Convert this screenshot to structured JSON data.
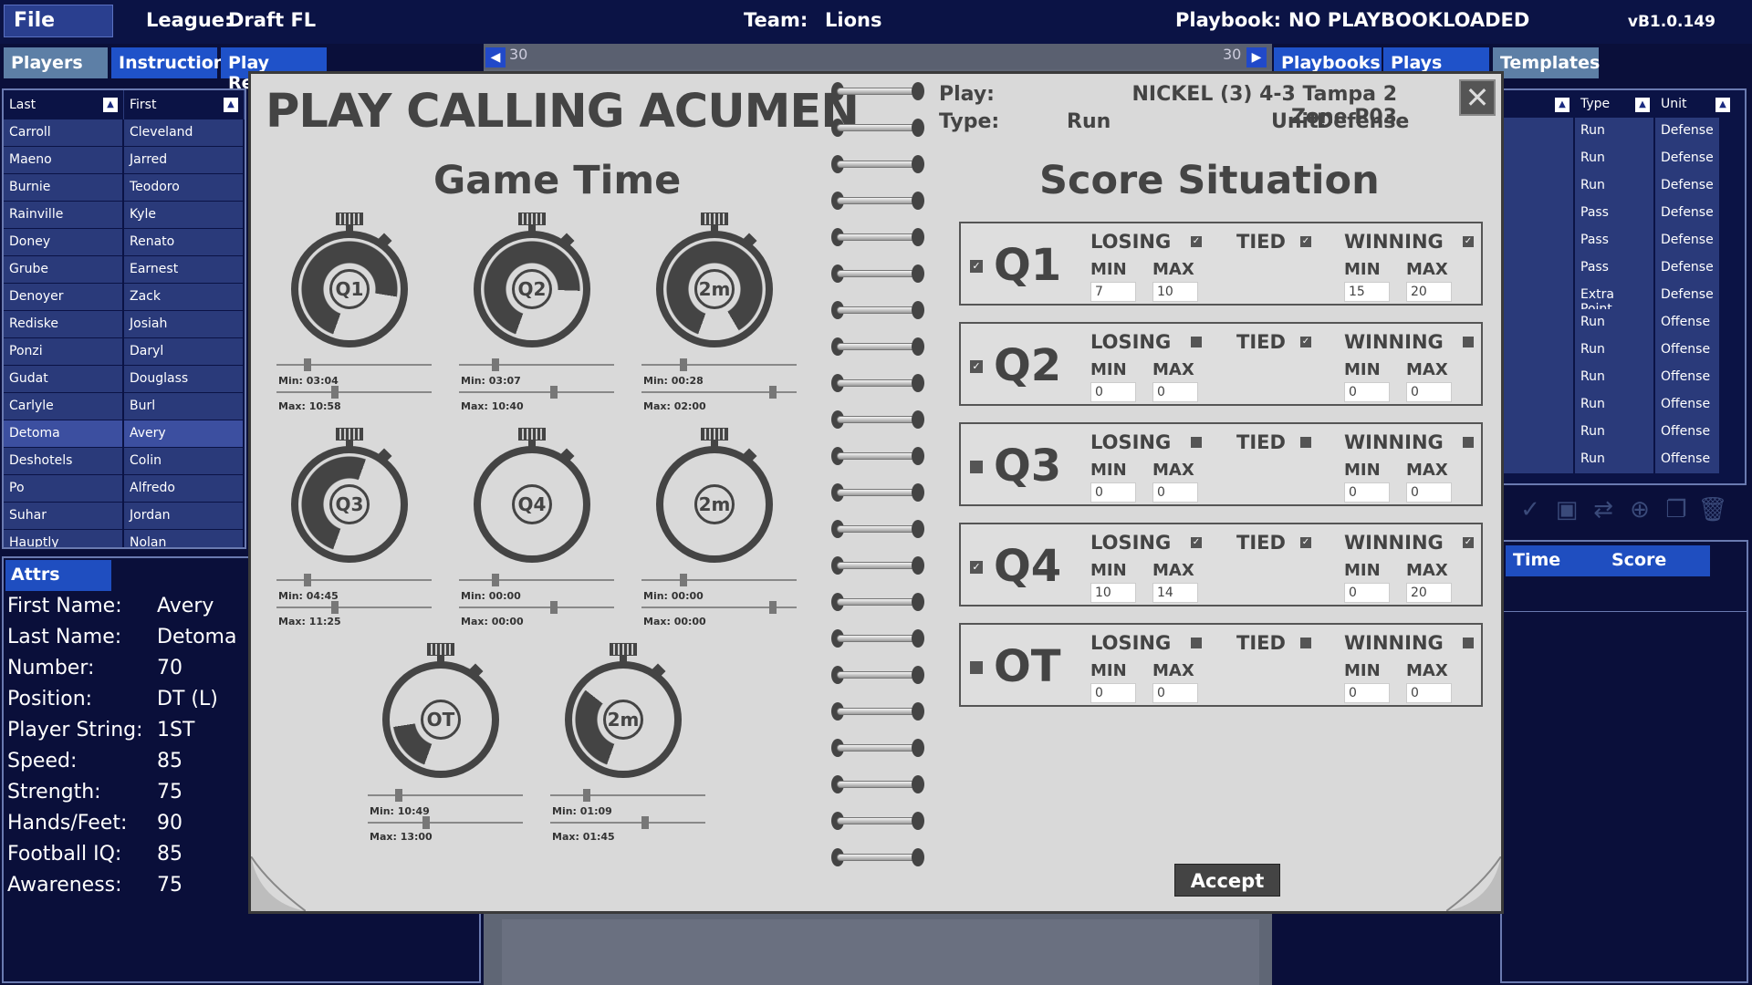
{
  "topbar": {
    "file": "File",
    "league_label": "League:",
    "league_value": "Draft FL",
    "team_label": "Team:",
    "team_value": "Lions",
    "playbook_label": "Playbook:",
    "playbook_value": "NO PLAYBOOKLOADED",
    "version": "vB1.0.149"
  },
  "left_tabs": [
    "Players",
    "Instruction",
    "Play Result"
  ],
  "right_tabs": [
    "Playbooks",
    "Plays",
    "Templates"
  ],
  "players_table": {
    "headers": [
      "Last",
      "First"
    ],
    "rows": [
      [
        "Carroll",
        "Cleveland"
      ],
      [
        "Maeno",
        "Jarred"
      ],
      [
        "Burnie",
        "Teodoro"
      ],
      [
        "Rainville",
        "Kyle"
      ],
      [
        "Doney",
        "Renato"
      ],
      [
        "Grube",
        "Earnest"
      ],
      [
        "Denoyer",
        "Zack"
      ],
      [
        "Rediske",
        "Josiah"
      ],
      [
        "Ponzi",
        "Daryl"
      ],
      [
        "Gudat",
        "Douglass"
      ],
      [
        "Carlyle",
        "Burl"
      ],
      [
        "Detoma",
        "Avery"
      ],
      [
        "Deshotels",
        "Colin"
      ],
      [
        "Po",
        "Alfredo"
      ],
      [
        "Suhar",
        "Jordan"
      ],
      [
        "Hauptly",
        "Nolan"
      ]
    ]
  },
  "attrs": {
    "tab": "Attrs",
    "rows": [
      [
        "First Name:",
        "Avery"
      ],
      [
        "Last Name:",
        "Detoma"
      ],
      [
        "Number:",
        "70"
      ],
      [
        "Position:",
        "DT (L)"
      ],
      [
        "Player String:",
        "1ST"
      ],
      [
        "Speed:",
        "85"
      ],
      [
        "Strength:",
        "75"
      ],
      [
        "Hands/Feet:",
        "90"
      ],
      [
        "Football IQ:",
        "85"
      ],
      [
        "Awareness:",
        "75"
      ]
    ]
  },
  "field": {
    "yard_left": "30",
    "yard_right": "30"
  },
  "plays_table": {
    "headers": [
      "Type",
      "Unit"
    ],
    "rows": [
      [
        "Run",
        "Defense"
      ],
      [
        "Run",
        "Defense"
      ],
      [
        "Run",
        "Defense"
      ],
      [
        "Pass",
        "Defense"
      ],
      [
        "Pass",
        "Defense"
      ],
      [
        "Pass",
        "Defense"
      ],
      [
        "Extra Point",
        "Defense"
      ],
      [
        "Run",
        "Offense"
      ],
      [
        "Run",
        "Offense"
      ],
      [
        "Run",
        "Offense"
      ],
      [
        "Run",
        "Offense"
      ],
      [
        "Run",
        "Offense"
      ],
      [
        "Run",
        "Offense"
      ]
    ]
  },
  "right_bottom_tabs": [
    "Time",
    "Score"
  ],
  "modal": {
    "title": "PLAY CALLING ACUMEN",
    "play_label": "Play:",
    "play_value": "NICKEL (3) 4-3 Tampa 2 Zone P03",
    "type_label": "Type:",
    "type_value": "Run",
    "unit_label": "Unit:",
    "unit_value": "Defense",
    "game_time_title": "Game Time",
    "score_title": "Score Situation",
    "accept": "Accept",
    "close": "✕",
    "timers": [
      {
        "label": "Q1",
        "min": "Min:  03:04",
        "max": "Max: 10:58",
        "fill": 0.72
      },
      {
        "label": "Q2",
        "min": "Min:  03:07",
        "max": "Max: 10:40",
        "fill": 0.7
      },
      {
        "label": "2m",
        "min": "Min:  00:28",
        "max": "Max: 02:00",
        "fill": 0.86
      },
      {
        "label": "Q3",
        "min": "Min:  04:45",
        "max": "Max: 11:25",
        "fill": 0.5
      },
      {
        "label": "Q4",
        "min": "Min:  00:00",
        "max": "Max: 00:00",
        "fill": 0
      },
      {
        "label": "2m",
        "min": "Min:  00:00",
        "max": "Max: 00:00",
        "fill": 0
      },
      {
        "label": "OT",
        "min": "Min:  10:49",
        "max": "Max: 13:00",
        "fill": 0.17
      },
      {
        "label": "2m",
        "min": "Min:  01:09",
        "max": "Max: 01:45",
        "fill": 0.3
      }
    ],
    "score_rows": [
      {
        "q": "Q1",
        "on": true,
        "losing": true,
        "tied": true,
        "winning": true,
        "lmin": "7",
        "lmax": "10",
        "wmin": "15",
        "wmax": "20"
      },
      {
        "q": "Q2",
        "on": true,
        "losing": false,
        "tied": true,
        "winning": false,
        "lmin": "0",
        "lmax": "0",
        "wmin": "0",
        "wmax": "0"
      },
      {
        "q": "Q3",
        "on": false,
        "losing": false,
        "tied": false,
        "winning": false,
        "lmin": "0",
        "lmax": "0",
        "wmin": "0",
        "wmax": "0"
      },
      {
        "q": "Q4",
        "on": true,
        "losing": true,
        "tied": true,
        "winning": true,
        "lmin": "10",
        "lmax": "14",
        "wmin": "0",
        "wmax": "20"
      },
      {
        "q": "OT",
        "on": false,
        "losing": false,
        "tied": false,
        "winning": false,
        "lmin": "0",
        "lmax": "0",
        "wmin": "0",
        "wmax": "0"
      }
    ],
    "labels": {
      "losing": "LOSING",
      "tied": "TIED",
      "winning": "WINNING",
      "min": "MIN",
      "max": "MAX"
    }
  }
}
